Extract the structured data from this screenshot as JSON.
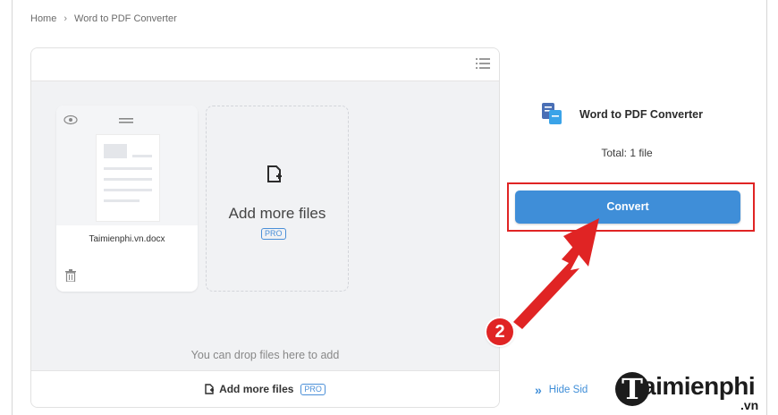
{
  "breadcrumb": {
    "home": "Home",
    "separator": "›",
    "current": "Word to PDF Converter"
  },
  "file_panel": {
    "file": {
      "name": "Taimienphi.vn.docx"
    },
    "add_card": {
      "label": "Add more files",
      "badge": "PRO"
    },
    "drop_hint": "You can drop files here to add",
    "bottom_bar": {
      "label": "Add more files",
      "badge": "PRO"
    }
  },
  "sidebar": {
    "tool_name": "Word to PDF Converter",
    "total": "Total: 1 file",
    "convert_label": "Convert",
    "hide_label": "Hide Sid",
    "hide_icon": "»"
  },
  "annotation": {
    "step_number": "2",
    "color": "#e02424"
  },
  "watermark": {
    "brand": "aimienphi",
    "brand_initial": "T",
    "tld": ".vn"
  },
  "colors": {
    "accent": "#3f8ed8",
    "annotation": "#e02424"
  }
}
